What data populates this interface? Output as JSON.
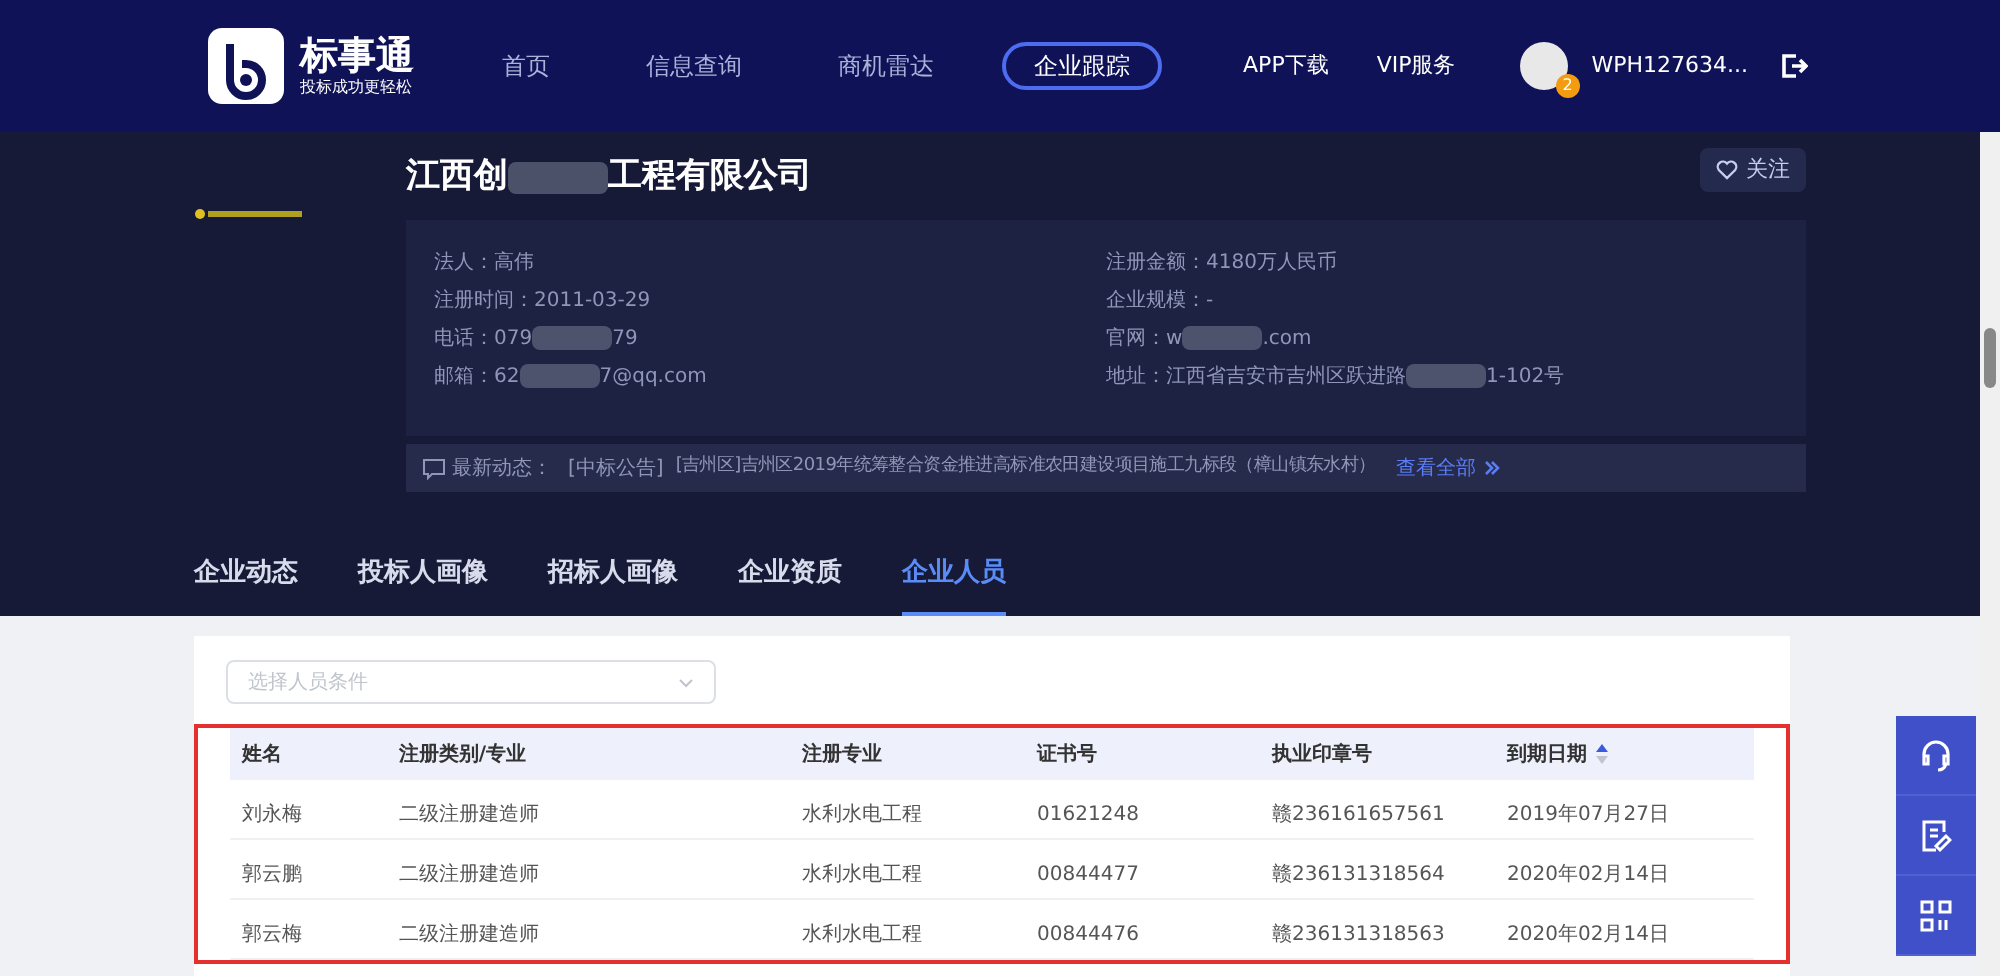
{
  "header": {
    "logo": {
      "name": "标事通",
      "slogan": "投标成功更轻松"
    },
    "nav": [
      {
        "label": "首页",
        "selected": false
      },
      {
        "label": "信息查询",
        "selected": false
      },
      {
        "label": "商机雷达",
        "selected": false
      },
      {
        "label": "企业跟踪",
        "selected": true
      }
    ],
    "links": [
      "APP下载",
      "VIP服务"
    ],
    "user": {
      "badge": "2",
      "name": "WPH127634..."
    }
  },
  "company": {
    "name_parts": [
      "江西创",
      "工程有限公司"
    ],
    "follow": "关注",
    "info_left": [
      {
        "label": "法人：",
        "parts": [
          "高伟"
        ]
      },
      {
        "label": "注册时间：",
        "parts": [
          "2011-03-29"
        ]
      },
      {
        "label": "电话：",
        "parts": [
          "079",
          "79"
        ]
      },
      {
        "label": "邮箱：",
        "parts": [
          "62",
          "7@qq.com"
        ]
      }
    ],
    "info_right": [
      {
        "label": "注册金额：",
        "parts": [
          "4180万人民币"
        ]
      },
      {
        "label": "企业规模：",
        "parts": [
          "-"
        ]
      },
      {
        "label": "官网：",
        "parts": [
          "w",
          ".com"
        ]
      },
      {
        "label": "地址：",
        "parts": [
          "江西省吉安市吉州区跃进路",
          "1-102号"
        ]
      }
    ],
    "news": {
      "label": "最新动态：",
      "tag": "[中标公告]",
      "text": "[吉州区]吉州区2019年统筹整合资金推进高标准农田建设项目施工九标段（樟山镇东水村）",
      "more": "查看全部"
    }
  },
  "tabs": [
    {
      "label": "企业动态",
      "selected": false
    },
    {
      "label": "投标人画像",
      "selected": false
    },
    {
      "label": "招标人画像",
      "selected": false
    },
    {
      "label": "企业资质",
      "selected": false
    },
    {
      "label": "企业人员",
      "selected": true
    }
  ],
  "filter": {
    "placeholder": "选择人员条件"
  },
  "table": {
    "highlighted": true,
    "columns": [
      {
        "label": "姓名",
        "kind": "plain"
      },
      {
        "label": "注册类别/专业",
        "kind": "plain"
      },
      {
        "label": "注册专业",
        "kind": "plain"
      },
      {
        "label": "证书号",
        "kind": "plain"
      },
      {
        "label": "执业印章号",
        "kind": "plain"
      },
      {
        "label": "到期日期",
        "kind": "sortable"
      }
    ],
    "rows": [
      [
        "刘永梅",
        "二级注册建造师",
        "水利水电工程",
        "01621248",
        "赣236161657561",
        "2019年07月27日"
      ],
      [
        "郭云鹏",
        "二级注册建造师",
        "水利水电工程",
        "00844477",
        "赣236131318564",
        "2020年02月14日"
      ],
      [
        "郭云梅",
        "二级注册建造师",
        "水利水电工程",
        "00844476",
        "赣236131318563",
        "2020年02月14日"
      ]
    ]
  }
}
